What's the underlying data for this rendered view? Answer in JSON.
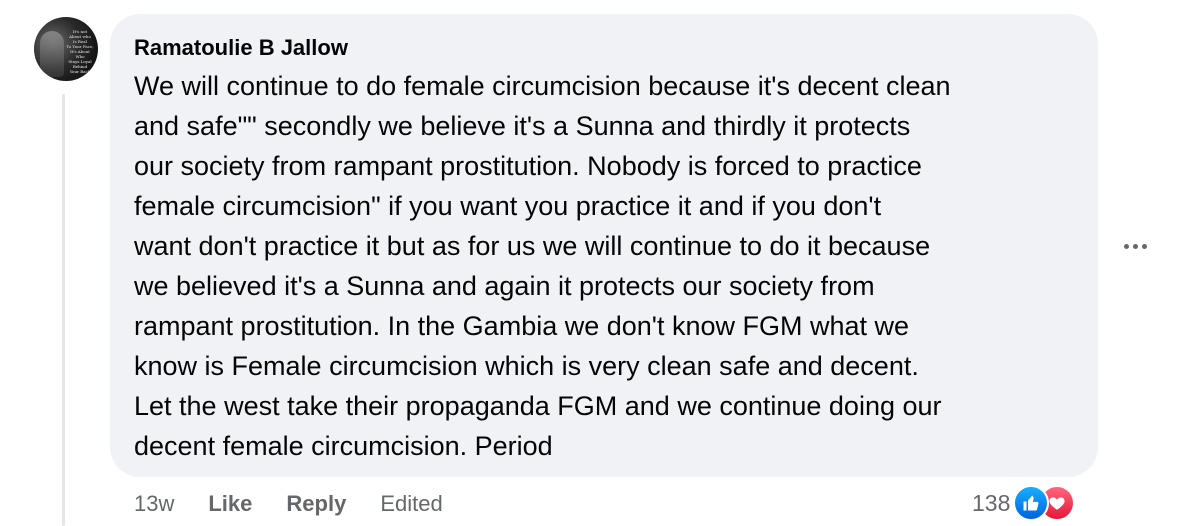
{
  "comment": {
    "author": "Ramatoulie B Jallow",
    "text": "We will continue to do female circumcision because it's decent clean\nand safe\"\" secondly we believe it's a Sunna and thirdly it protects\nour society from rampant prostitution. Nobody is forced to practice\nfemale circumcision\" if you want you practice it and if you don't\nwant don't practice it but as for us we will continue to do it because\nwe believed it's a Sunna and again it protects our society from\nrampant prostitution. In the Gambia we don't know FGM what we\nknow is Female circumcision which is very clean safe and decent.\nLet the west take their propaganda FGM and we continue doing our\ndecent female circumcision. Period",
    "avatar_text": "It's not\nAbout who\nIs Real\nTo Your Face,\nIt's About\nWho\nStays Loyal\nBehind\nYour Back"
  },
  "actions": {
    "time": "13w",
    "like_label": "Like",
    "reply_label": "Reply",
    "edited_label": "Edited"
  },
  "reactions": {
    "count": "138",
    "icons": [
      "like-icon",
      "love-icon"
    ]
  },
  "colors": {
    "bubble_bg": "#f0f2f5",
    "secondary_text": "#65676b",
    "like_blue": "#0866ff",
    "love_red": "#f33e58"
  }
}
